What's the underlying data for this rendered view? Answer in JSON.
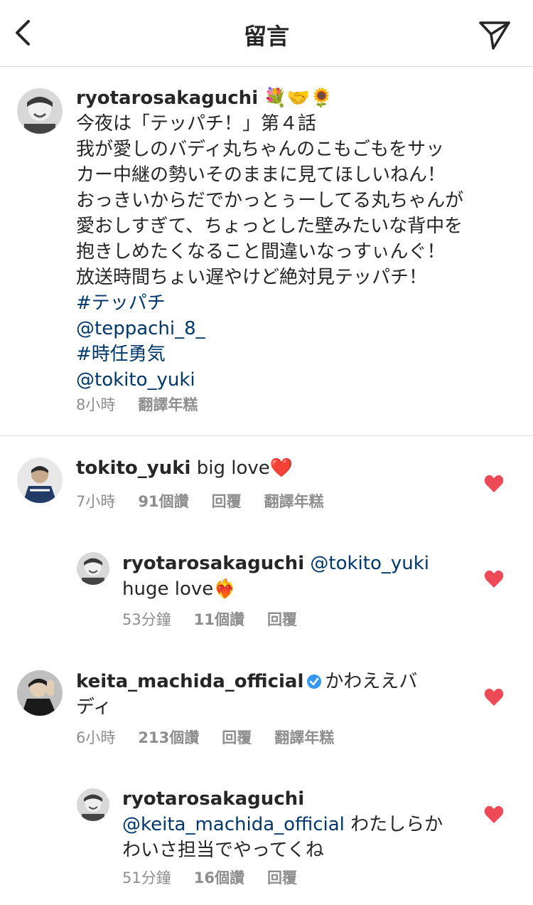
{
  "header": {
    "title": "留言"
  },
  "caption": {
    "username": "ryotarosakaguchi",
    "emojis": "💐🤝🌻",
    "lines": [
      "今夜は「テッパチ！」第４話",
      "我が愛しのバディ丸ちゃんのこもごもをサッ",
      "カー中継の勢いそのままに見てほしいねん！",
      "おっきいからだでかっとぅーしてる丸ちゃんが",
      "愛おしすぎて、ちょっとした壁みたいな背中を",
      "抱きしめたくなること間違いなっすぃんぐ！",
      "放送時間ちょい遅やけど絶対見テッパチ！"
    ],
    "tags": [
      "#テッパチ",
      "@teppachi_8_",
      "#時任勇気",
      "@tokito_yuki"
    ],
    "time": "8小時",
    "translate": "翻譯年糕"
  },
  "comments": [
    {
      "username": "tokito_yuki",
      "text": "big love❤️",
      "time": "7小時",
      "likes": "91個讚",
      "reply": "回覆",
      "translate": "翻譯年糕"
    },
    {
      "username": "ryotarosakaguchi",
      "mention": "@tokito_yuki",
      "text": "huge love❤️‍🔥",
      "time": "53分鐘",
      "likes": "11個讚",
      "reply": "回覆"
    },
    {
      "username": "keita_machida_official",
      "text_line1": "かわええバ",
      "text_line2": "ディ",
      "time": "6小時",
      "likes": "213個讚",
      "reply": "回覆",
      "translate": "翻譯年糕"
    },
    {
      "username": "ryotarosakaguchi",
      "mention": "@keita_machida_official",
      "text_line1": "わたしらか",
      "text_line2": "わいさ担当でやってくね",
      "time": "51分鐘",
      "likes": "16個讚",
      "reply": "回覆"
    }
  ],
  "colors": {
    "heart": "#ed4956",
    "link": "#00376b",
    "meta": "#8e8e8e",
    "verified": "#3897f0"
  }
}
